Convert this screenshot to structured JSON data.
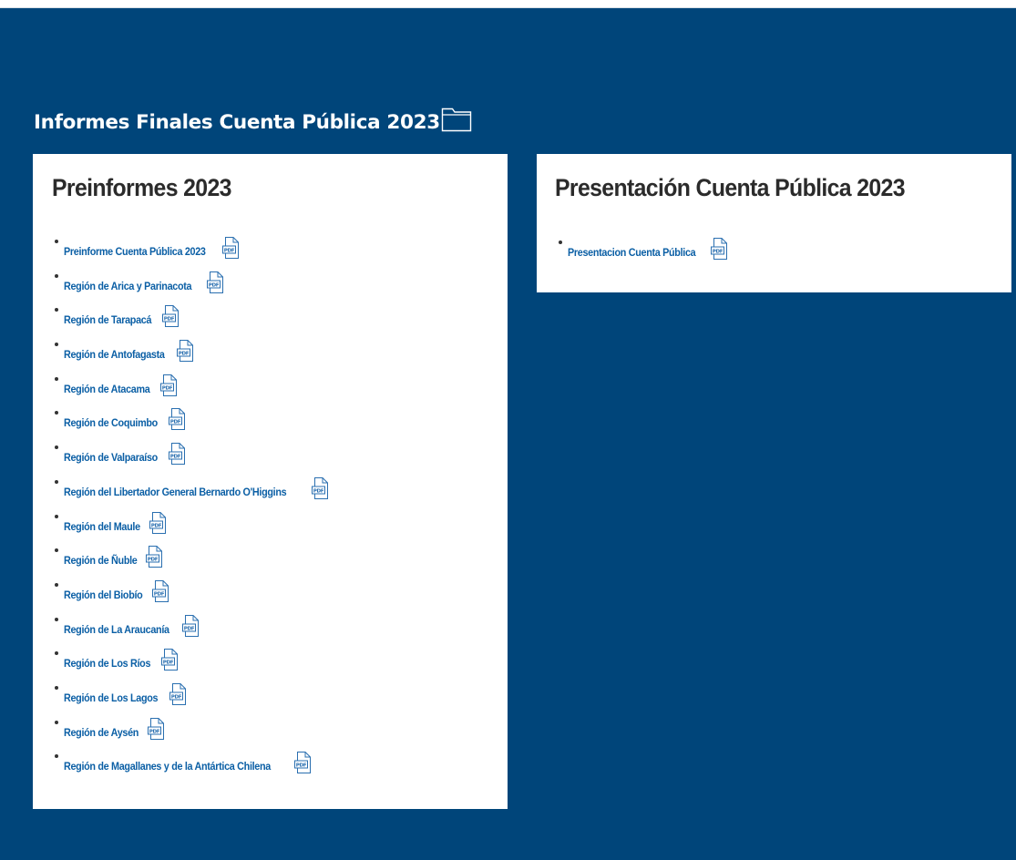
{
  "section": {
    "title": "Informes Finales Cuenta Pública 2023",
    "icon": "folder-icon"
  },
  "left_panel": {
    "heading": "Preinformes 2023",
    "links": [
      {
        "label": "Preinforme Cuenta Pública 2023",
        "icon": "pdf-icon"
      },
      {
        "label": "Región de Arica y Parinacota",
        "icon": "pdf-icon"
      },
      {
        "label": "Región de Tarapacá",
        "icon": "pdf-icon"
      },
      {
        "label": "Región de Antofagasta",
        "icon": "pdf-icon"
      },
      {
        "label": "Región de Atacama",
        "icon": "pdf-icon"
      },
      {
        "label": "Región de Coquimbo",
        "icon": "pdf-icon"
      },
      {
        "label": "Región de Valparaíso",
        "icon": "pdf-icon"
      },
      {
        "label": "Región del Libertador General Bernardo O'Higgins",
        "icon": "pdf-icon"
      },
      {
        "label": "Región del Maule",
        "icon": "pdf-icon"
      },
      {
        "label": "Región de Ñuble",
        "icon": "pdf-icon"
      },
      {
        "label": "Región del Biobío",
        "icon": "pdf-icon"
      },
      {
        "label": "Región de La Araucanía",
        "icon": "pdf-icon"
      },
      {
        "label": "Región de Los Ríos",
        "icon": "pdf-icon"
      },
      {
        "label": "Región de Los Lagos",
        "icon": "pdf-icon"
      },
      {
        "label": "Región de Aysén",
        "icon": "pdf-icon"
      },
      {
        "label": "Región de Magallanes y de la Antártica Chilena",
        "icon": "pdf-icon"
      }
    ]
  },
  "right_panel": {
    "heading": "Presentación Cuenta Pública 2023",
    "links": [
      {
        "label": "Presentacion Cuenta Pública",
        "icon": "pdf-icon"
      }
    ]
  },
  "colors": {
    "background": "#00457a",
    "panel": "#ffffff",
    "link": "#0b5fa5",
    "heading": "#2b2b2b"
  }
}
